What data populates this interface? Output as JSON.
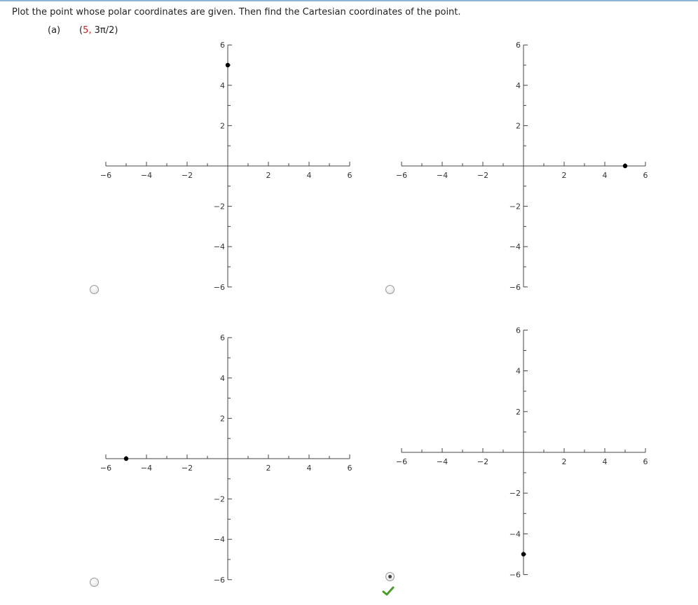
{
  "question": {
    "prompt": "Plot the point whose polar coordinates are given. Then find the Cartesian coordinates of the point.",
    "part_label": "(a)",
    "coords_open": "(",
    "coords_r": "5,",
    "coords_theta": "3π/2)"
  },
  "colors": {
    "top_rule": "#8fb4d9",
    "axis": "#444444",
    "point": "#000000",
    "check": "#4a9a2a",
    "coords_highlight": "#cc2222"
  },
  "icons": {
    "check": "check-icon",
    "radio": "radio-button"
  },
  "options": [
    {
      "name": "option-a",
      "selected": false,
      "point": [
        0,
        5
      ]
    },
    {
      "name": "option-b",
      "selected": false,
      "point": [
        5,
        0
      ]
    },
    {
      "name": "option-c",
      "selected": false,
      "point": [
        -5,
        0
      ]
    },
    {
      "name": "option-d",
      "selected": true,
      "point": [
        0,
        -5
      ]
    }
  ],
  "chart_data": [
    {
      "type": "scatter",
      "x": [
        0
      ],
      "y": [
        5
      ],
      "xlim": [
        -6,
        6
      ],
      "ylim": [
        -6,
        6
      ],
      "x_ticks": [
        "−6",
        "−4",
        "−2",
        "2",
        "4",
        "6"
      ],
      "y_ticks": [
        "6",
        "4",
        "2",
        "−2",
        "−4",
        "−6"
      ],
      "grid": false
    },
    {
      "type": "scatter",
      "x": [
        5
      ],
      "y": [
        0
      ],
      "xlim": [
        -6,
        6
      ],
      "ylim": [
        -6,
        6
      ],
      "x_ticks": [
        "−6",
        "−4",
        "−2",
        "2",
        "4",
        "6"
      ],
      "y_ticks": [
        "6",
        "4",
        "2",
        "−2",
        "−4",
        "−6"
      ],
      "grid": false
    },
    {
      "type": "scatter",
      "x": [
        -5
      ],
      "y": [
        0
      ],
      "xlim": [
        -6,
        6
      ],
      "ylim": [
        -6,
        6
      ],
      "x_ticks": [
        "−6",
        "−4",
        "−2",
        "2",
        "4",
        "6"
      ],
      "y_ticks": [
        "6",
        "4",
        "2",
        "−2",
        "−4",
        "−6"
      ],
      "grid": false
    },
    {
      "type": "scatter",
      "x": [
        0
      ],
      "y": [
        -5
      ],
      "xlim": [
        -6,
        6
      ],
      "ylim": [
        -6,
        6
      ],
      "x_ticks": [
        "−6",
        "−4",
        "−2",
        "2",
        "4",
        "6"
      ],
      "y_ticks": [
        "6",
        "4",
        "2",
        "−2",
        "−4",
        "−6"
      ],
      "grid": false
    }
  ]
}
